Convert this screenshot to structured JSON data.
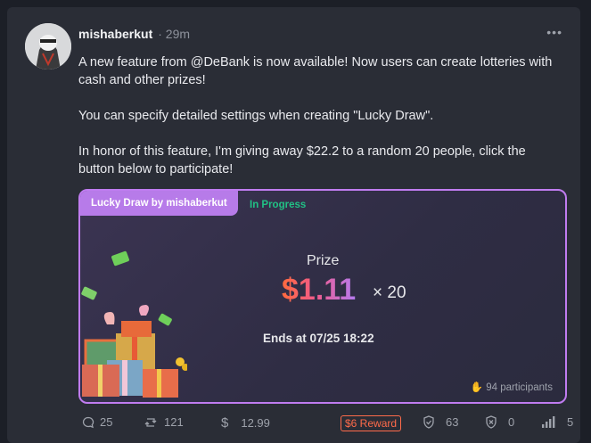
{
  "post": {
    "author": "mishaberkut",
    "time": "· 29m",
    "more": "•••",
    "paragraphs": [
      "A new feature from @DeBank is now available! Now users can create lotteries with cash and other prizes!",
      "You can specify detailed settings when creating \"Lucky Draw\".",
      "In honor of this feature, I'm giving away $22.2 to a random 20 people, click the button below to participate!"
    ]
  },
  "lottery": {
    "tag": "Lucky Draw by mishaberkut",
    "status": "In Progress",
    "prize_label": "Prize",
    "amount": "$1.11",
    "multiplier": "× 20",
    "ends": "Ends at 07/25 18:22",
    "participants": "94 participants",
    "colors": {
      "border": "#c07cf0",
      "tag": "#b77be9",
      "status": "#21c185",
      "amount": "#ff6a4a"
    }
  },
  "footer": {
    "comments": "25",
    "reposts": "121",
    "tips": "12.99",
    "reward": "$6 Reward",
    "trust": "63",
    "distrust": "0",
    "views": "5"
  }
}
